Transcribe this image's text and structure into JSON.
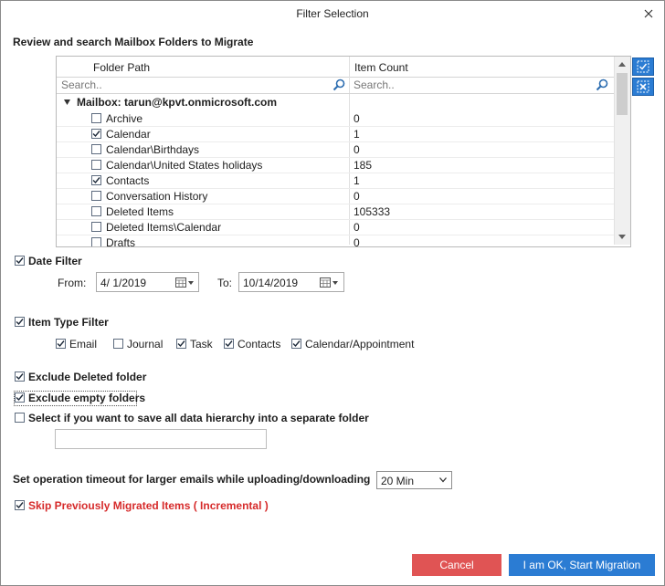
{
  "window": {
    "title": "Filter Selection"
  },
  "folders": {
    "section_label": "Review and search Mailbox Folders to Migrate",
    "col_path": "Folder Path",
    "col_count": "Item Count",
    "search_path_placeholder": "Search..",
    "search_count_placeholder": "Search..",
    "mailbox_label": "Mailbox: tarun@kpvt.onmicrosoft.com",
    "rows": [
      {
        "name": "Archive",
        "count": "0",
        "checked": false
      },
      {
        "name": "Calendar",
        "count": "1",
        "checked": true
      },
      {
        "name": "Calendar\\Birthdays",
        "count": "0",
        "checked": false
      },
      {
        "name": "Calendar\\United States holidays",
        "count": "185",
        "checked": false
      },
      {
        "name": "Contacts",
        "count": "1",
        "checked": true
      },
      {
        "name": "Conversation History",
        "count": "0",
        "checked": false
      },
      {
        "name": "Deleted Items",
        "count": "105333",
        "checked": false
      },
      {
        "name": "Deleted Items\\Calendar",
        "count": "0",
        "checked": false
      },
      {
        "name": "Drafts",
        "count": "0",
        "checked": false
      }
    ]
  },
  "date_filter": {
    "label": "Date Filter",
    "checked": true,
    "from_label": "From:",
    "from_value": "4/  1/2019",
    "to_label": "To:",
    "to_value": "10/14/2019"
  },
  "item_type_filter": {
    "label": "Item Type Filter",
    "checked": true,
    "types": [
      {
        "label": "Email",
        "checked": true
      },
      {
        "label": "Journal",
        "checked": false
      },
      {
        "label": "Task",
        "checked": true
      },
      {
        "label": "Contacts",
        "checked": true
      },
      {
        "label": "Calendar/Appointment",
        "checked": true
      }
    ]
  },
  "options": {
    "exclude_deleted": {
      "label": "Exclude Deleted folder",
      "checked": true
    },
    "exclude_empty": {
      "label": "Exclude empty folders",
      "checked": true
    },
    "save_hierarchy": {
      "label": "Select if you want to save all data hierarchy into a separate folder",
      "checked": false,
      "value": ""
    }
  },
  "timeout": {
    "label": "Set operation timeout for larger emails while uploading/downloading",
    "value": "20 Min"
  },
  "incremental": {
    "label": "Skip Previously Migrated Items ( Incremental )",
    "checked": true,
    "color": "#d62b2b"
  },
  "buttons": {
    "cancel": "Cancel",
    "ok": "I am OK, Start Migration"
  },
  "colors": {
    "accent": "#2b7cd3",
    "cancel": "#e05454"
  }
}
